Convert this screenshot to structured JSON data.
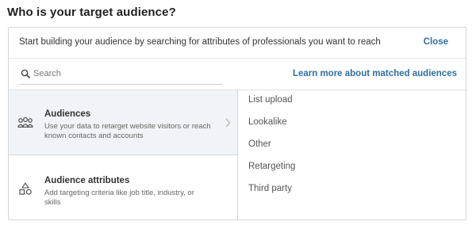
{
  "title": "Who is your target audience?",
  "intro": {
    "text": "Start building your audience by searching for attributes of professionals you want to reach",
    "close_label": "Close"
  },
  "search": {
    "placeholder": "Search",
    "value": "",
    "icon": "search-icon"
  },
  "learn_more_label": "Learn more about matched audiences",
  "categories": [
    {
      "title": "Audiences",
      "description": "Use your data to retarget website visitors or reach known contacts and accounts",
      "icon": "people-group-icon",
      "selected": true
    },
    {
      "title": "Audience attributes",
      "description": "Add targeting criteria like job title, industry, or skills",
      "icon": "shapes-icon",
      "selected": false
    }
  ],
  "options": [
    "List upload",
    "Lookalike",
    "Other",
    "Retargeting",
    "Third party"
  ],
  "colors": {
    "link": "#2f6f9f",
    "selected_bg": "#f0f3f7",
    "border": "#d6d6d6"
  }
}
